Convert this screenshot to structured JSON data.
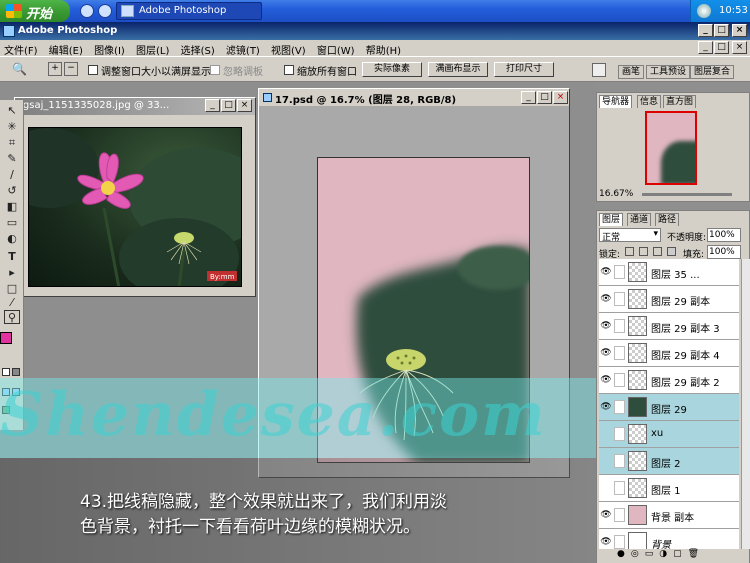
{
  "taskbar": {
    "start_label": "开始",
    "task_label": "Adobe Photoshop",
    "clock": "10:53"
  },
  "app": {
    "title": "Adobe Photoshop",
    "menu": [
      "文件(F)",
      "编辑(E)",
      "图像(I)",
      "图层(L)",
      "选择(S)",
      "滤镜(T)",
      "视图(V)",
      "窗口(W)",
      "帮助(H)"
    ]
  },
  "options": {
    "resize_label": "调整窗口大小以满屏显示",
    "ignore_palettes_label": "忽略调板",
    "zoom_all_label": "缩放所有窗口",
    "actual_pixels": "实际像素",
    "fit_screen": "满画布显示",
    "print_size": "打印尺寸",
    "palette_tabs": [
      "画笔",
      "工具预设",
      "图层复合"
    ]
  },
  "documents": {
    "photo_title": "tgsaj_1151335028.jpg @ 33...",
    "photo_signature": "By:mm",
    "main_title": "17.psd @ 16.7% (图层 28, RGB/8)"
  },
  "watermark": "Shendesea.com",
  "caption": {
    "line1": "43.把线稿隐藏，整个效果就出来了，我们利用淡",
    "line2": "色背景，衬托一下看看荷叶边缘的模糊状况。"
  },
  "navigator": {
    "tabs": [
      "导航器",
      "信息",
      "直方图"
    ],
    "zoom": "16.67%"
  },
  "layers_panel": {
    "tabs": [
      "图层",
      "通道",
      "路径"
    ],
    "blend_mode": "正常",
    "opacity_label": "不透明度:",
    "opacity_value": "100%",
    "lock_label": "锁定:",
    "fill_label": "填充:",
    "fill_value": "100%",
    "rows": [
      {
        "name": "图层 35 ...",
        "visible": true
      },
      {
        "name": "图层 29 副本",
        "visible": true
      },
      {
        "name": "图层 29 副本 3",
        "visible": true
      },
      {
        "name": "图层 29 副本 4",
        "visible": true
      },
      {
        "name": "图层 29 副本 2",
        "visible": true
      },
      {
        "name": "图层 29",
        "visible": true,
        "selected": true
      },
      {
        "name": "xu",
        "visible": false
      },
      {
        "name": "图层 2",
        "visible": false
      },
      {
        "name": "图层 1",
        "visible": false
      },
      {
        "name": "背景 副本",
        "visible": true
      },
      {
        "name": "背景",
        "visible": true
      }
    ]
  },
  "colors": {
    "canvas_bg": "#e0b6c1",
    "leaf": "#2f4d3d",
    "lotus": "#e25ab3",
    "foreground_swatch": "#e0339f",
    "background_swatch": "#2e4b40"
  }
}
